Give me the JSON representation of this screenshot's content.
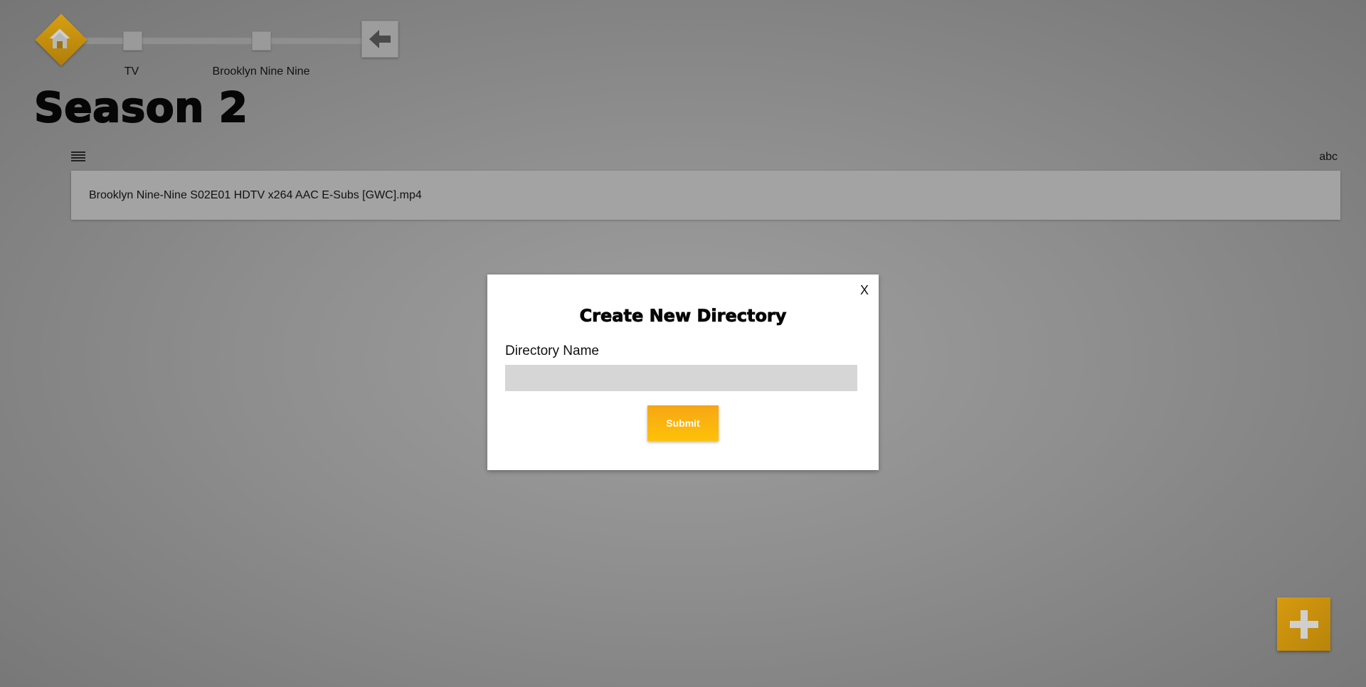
{
  "breadcrumb": {
    "items": [
      {
        "label": "TV"
      },
      {
        "label": "Brooklyn Nine Nine"
      }
    ]
  },
  "page": {
    "title": "Season 2"
  },
  "list_header": {
    "sort_label": "abc"
  },
  "files": [
    {
      "name": "Brooklyn Nine-Nine S02E01 HDTV x264 AAC E-Subs [GWC].mp4"
    }
  ],
  "modal": {
    "close_label": "X",
    "title": "Create New Directory",
    "field_label": "Directory Name",
    "input_value": "",
    "submit_label": "Submit"
  },
  "icons": {
    "home": "home-icon",
    "back": "arrow-left-icon",
    "menu": "hamburger-menu-icon",
    "add": "plus-icon"
  },
  "colors": {
    "accent": "#d79a10",
    "submit": "#ffb80a",
    "input_bg": "#d6d6d6",
    "background": "#8e8e8e"
  }
}
